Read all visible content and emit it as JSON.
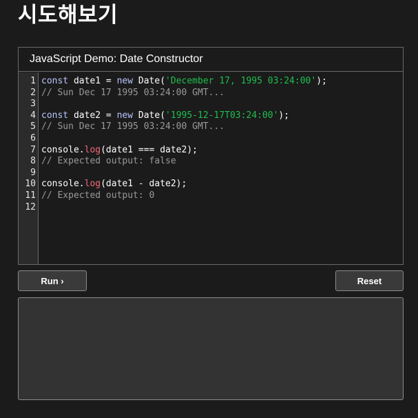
{
  "page": {
    "title": "시도해보기"
  },
  "editor": {
    "header": "JavaScript Demo: Date Constructor",
    "line_numbers": [
      "1",
      "2",
      "3",
      "4",
      "5",
      "6",
      "7",
      "8",
      "9",
      "10",
      "11",
      "12"
    ],
    "lines": [
      [
        {
          "t": "kw",
          "v": "const"
        },
        {
          "t": "plain",
          "v": " date1 = "
        },
        {
          "t": "kw",
          "v": "new"
        },
        {
          "t": "plain",
          "v": " Date("
        },
        {
          "t": "str",
          "v": "'December 17, 1995 03:24:00'"
        },
        {
          "t": "plain",
          "v": ");"
        }
      ],
      [
        {
          "t": "comment",
          "v": "// Sun Dec 17 1995 03:24:00 GMT..."
        }
      ],
      [],
      [
        {
          "t": "kw",
          "v": "const"
        },
        {
          "t": "plain",
          "v": " date2 = "
        },
        {
          "t": "kw",
          "v": "new"
        },
        {
          "t": "plain",
          "v": " Date("
        },
        {
          "t": "str",
          "v": "'1995-12-17T03:24:00'"
        },
        {
          "t": "plain",
          "v": ");"
        }
      ],
      [
        {
          "t": "comment",
          "v": "// Sun Dec 17 1995 03:24:00 GMT..."
        }
      ],
      [],
      [
        {
          "t": "plain",
          "v": "console."
        },
        {
          "t": "fn",
          "v": "log"
        },
        {
          "t": "plain",
          "v": "(date1 === date2);"
        }
      ],
      [
        {
          "t": "comment",
          "v": "// Expected output: false"
        }
      ],
      [],
      [
        {
          "t": "plain",
          "v": "console."
        },
        {
          "t": "fn",
          "v": "log"
        },
        {
          "t": "plain",
          "v": "(date1 - date2);"
        }
      ],
      [
        {
          "t": "comment",
          "v": "// Expected output: 0"
        }
      ],
      []
    ]
  },
  "buttons": {
    "run_label": "Run ›",
    "reset_label": "Reset"
  },
  "output": {
    "text": ""
  },
  "colors": {
    "background": "#1b1b1b",
    "keyword": "#b9c5ff",
    "string": "#1fbf4f",
    "function": "#f36a7a",
    "comment": "#9a9a9a"
  }
}
